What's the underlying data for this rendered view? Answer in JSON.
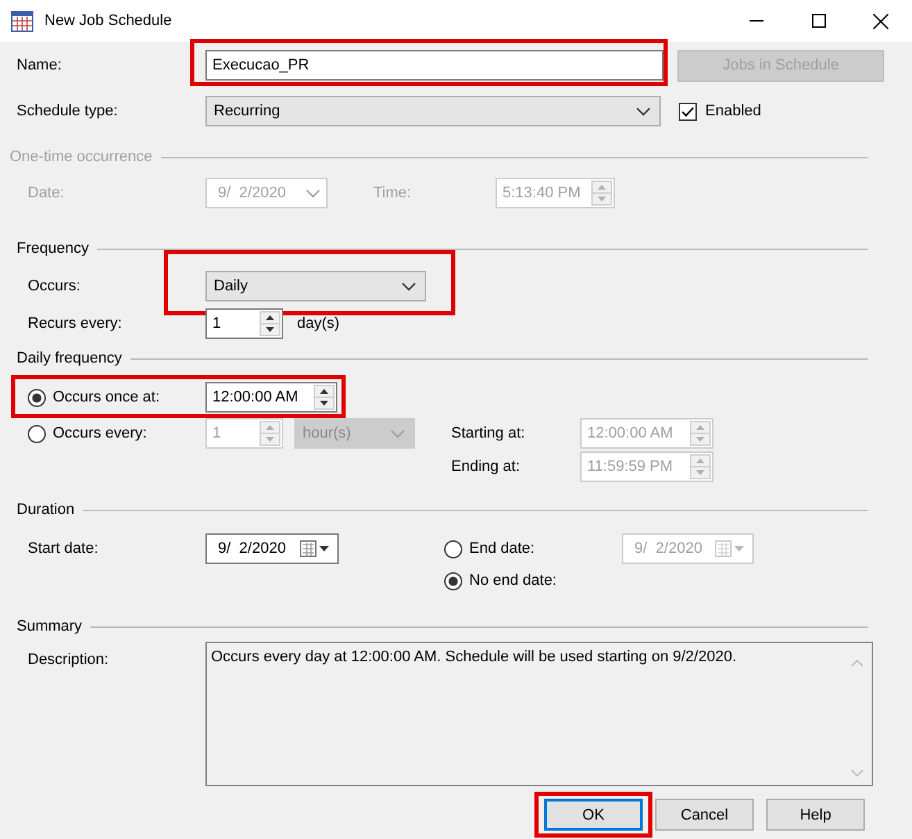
{
  "window": {
    "title": "New Job Schedule"
  },
  "name": {
    "label": "Name:",
    "value": "Execucao_PR",
    "highlighted": true
  },
  "jobs_button": {
    "label": "Jobs in Schedule",
    "disabled": true
  },
  "schedule_type": {
    "label": "Schedule type:",
    "value": "Recurring"
  },
  "enabled": {
    "label": "Enabled",
    "checked": true
  },
  "one_time": {
    "title": "One-time occurrence",
    "disabled": true,
    "date_label": "Date:",
    "date": "9/  2/2020",
    "time_label": "Time:",
    "time": "5:13:40 PM"
  },
  "frequency": {
    "title": "Frequency",
    "occurs_label": "Occurs:",
    "occurs": "Daily",
    "occurs_highlighted": true,
    "recurs_label": "Recurs every:",
    "recurs": "1",
    "recurs_unit": "day(s)"
  },
  "daily_frequency": {
    "title": "Daily frequency",
    "options": [
      {
        "label": "Occurs once at:",
        "selected": true,
        "highlighted": true,
        "time": "12:00:00 AM"
      },
      {
        "label": "Occurs every:",
        "selected": false,
        "highlighted": false,
        "interval": "1",
        "unit": "hour(s)"
      }
    ],
    "starting_label": "Starting at:",
    "starting": "12:00:00 AM",
    "ending_label": "Ending at:",
    "ending": "11:59:59 PM"
  },
  "duration": {
    "title": "Duration",
    "start_label": "Start date:",
    "start": "9/  2/2020",
    "end_options": [
      {
        "label": "End date:",
        "selected": false,
        "date": "9/  2/2020"
      },
      {
        "label": "No end date:",
        "selected": true
      }
    ]
  },
  "summary": {
    "title": "Summary",
    "description_label": "Description:",
    "description": "Occurs every day at 12:00:00 AM. Schedule will be used starting on 9/2/2020."
  },
  "buttons": [
    {
      "label": "OK",
      "default": true,
      "highlighted": true
    },
    {
      "label": "Cancel",
      "default": false,
      "highlighted": false
    },
    {
      "label": "Help",
      "default": false,
      "highlighted": false
    }
  ]
}
